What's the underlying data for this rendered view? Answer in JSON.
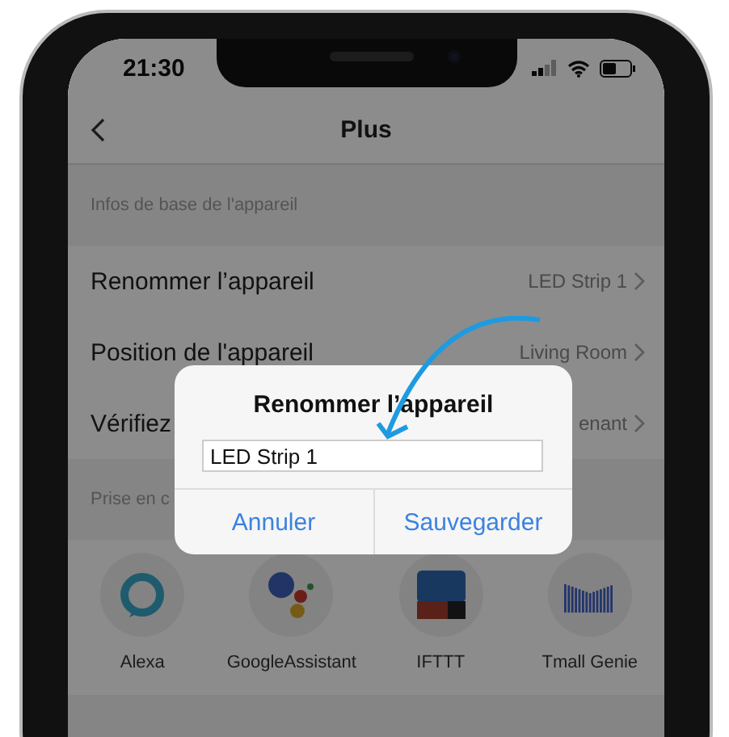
{
  "status_bar": {
    "time": "21:30"
  },
  "nav": {
    "title": "Plus"
  },
  "sections": [
    {
      "heading": "Infos de base de l'appareil",
      "rows": [
        {
          "label": "Renommer l’appareil",
          "value": "LED Strip 1"
        },
        {
          "label": "Position de l'appareil",
          "value": "Living Room"
        },
        {
          "label": "Vérifiez",
          "value": "enant"
        }
      ]
    },
    {
      "heading": "Prise en c",
      "integrations": [
        {
          "kind": "alexa",
          "label": "Alexa"
        },
        {
          "kind": "google",
          "label": "GoogleAssistant"
        },
        {
          "kind": "ifttt",
          "label": "IFTTT"
        },
        {
          "kind": "tmall",
          "label": "Tmall Genie"
        }
      ]
    }
  ],
  "dialog": {
    "title": "Renommer l’appareil",
    "field": {
      "value": "LED Strip 1"
    },
    "buttons": [
      "Annuler",
      "Sauvegarder"
    ]
  }
}
